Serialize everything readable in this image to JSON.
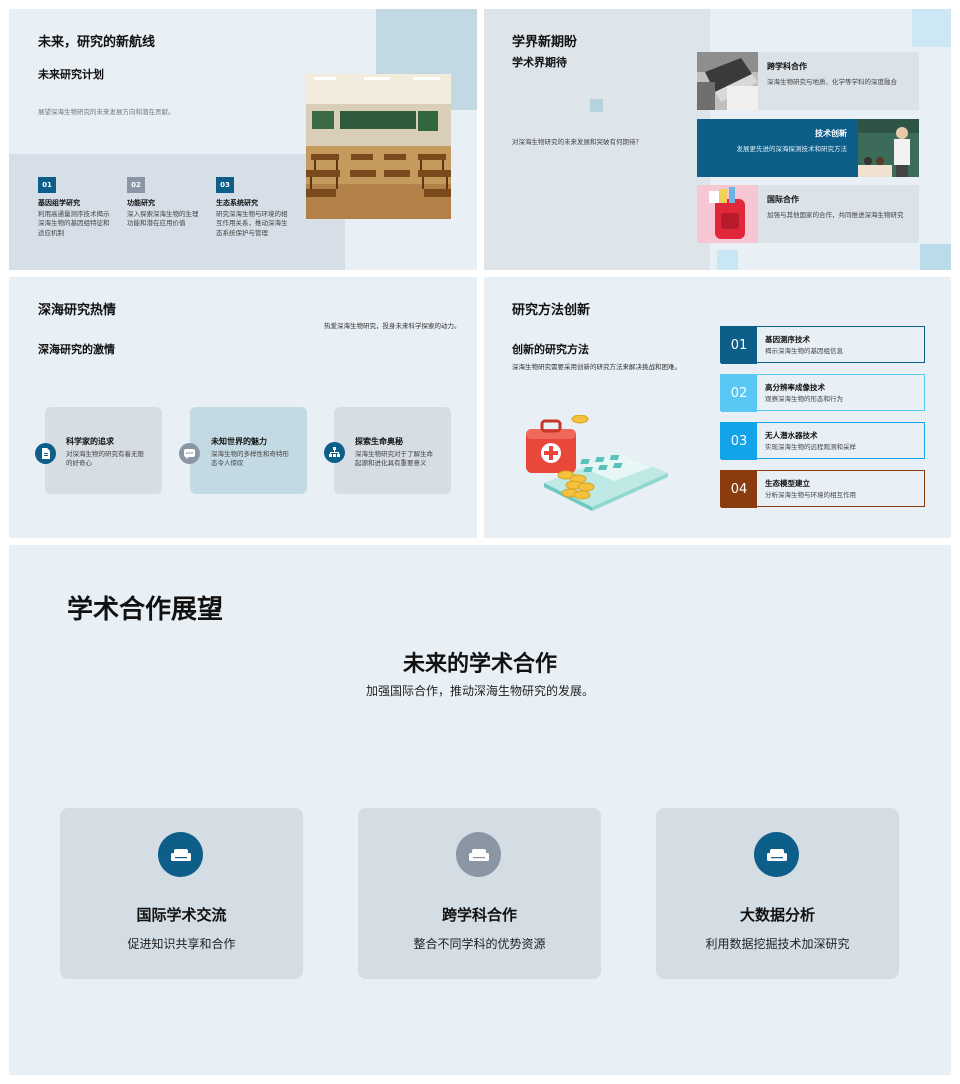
{
  "colors": {
    "slide_bg": "#e8eff5",
    "navy": "#0e5e8a",
    "gray": "#8a96a3",
    "light_blue": "#5ac8f5",
    "sky": "#12a3e8",
    "brown": "#8a3c0e"
  },
  "slide1": {
    "title": "未来，研究的新航线",
    "subtitle": "未来研究计划",
    "description": "展望深海生物研究的未来发展方向和潜在贡献。",
    "items": [
      {
        "num": "01",
        "title": "基因组学研究",
        "desc": "利用高通量测序技术揭示深海生物的基因组特征和适应机制"
      },
      {
        "num": "02",
        "title": "功能研究",
        "desc": "深入探索深海生物的生理功能和潜在应用价值"
      },
      {
        "num": "03",
        "title": "生态系统研究",
        "desc": "研究深海生物与环境的相互作用关系，推动深海生态系统保护与管理"
      }
    ]
  },
  "slide2": {
    "title": "学界新期盼",
    "subtitle": "学术界期待",
    "question": "对深海生物研究的未来发展和突破有何期待？",
    "cards": [
      {
        "title": "跨学科合作",
        "desc": "深海生物研究与地质、化学等学科的深度融合"
      },
      {
        "title": "技术创新",
        "desc": "发展更先进的深海探测技术和研究方法"
      },
      {
        "title": "国际合作",
        "desc": "加强与其他国家的合作，共同推进深海生物研究"
      }
    ]
  },
  "slide3": {
    "title": "深海研究热情",
    "tagline": "热爱深海生物研究，投身未来科学探索的动力。",
    "subtitle": "深海研究的激情",
    "cards": [
      {
        "title": "科学家的追求",
        "desc": "对深海生物的研究有着无限的好奇心",
        "icon": "document-icon"
      },
      {
        "title": "未知世界的魅力",
        "desc": "深海生物的多样性和奇特形态令人惊叹",
        "icon": "chat-icon"
      },
      {
        "title": "探索生命奥秘",
        "desc": "深海生物研究对于了解生命起源和进化具有重要意义",
        "icon": "network-icon"
      }
    ]
  },
  "slide4": {
    "title": "研究方法创新",
    "subtitle": "创新的研究方法",
    "description": "深海生物研究需要采用创新的研究方法来解决挑战和困难。",
    "methods": [
      {
        "num": "01",
        "title": "基因测序技术",
        "desc": "揭示深海生物的基因组信息"
      },
      {
        "num": "02",
        "title": "高分辨率成像技术",
        "desc": "观察深海生物的形态和行为"
      },
      {
        "num": "03",
        "title": "无人潜水器技术",
        "desc": "实现深海生物的远程观测和采样"
      },
      {
        "num": "04",
        "title": "生态模型建立",
        "desc": "分析深海生物与环境的相互作用"
      }
    ]
  },
  "slide5": {
    "title": "学术合作展望",
    "heading": "未来的学术合作",
    "description": "加强国际合作，推动深海生物研究的发展。",
    "cards": [
      {
        "title": "国际学术交流",
        "desc": "促进知识共享和合作",
        "icon": "sofa-icon"
      },
      {
        "title": "跨学科合作",
        "desc": "整合不同学科的优势资源",
        "icon": "sofa-icon"
      },
      {
        "title": "大数据分析",
        "desc": "利用数据挖掘技术加深研究",
        "icon": "sofa-icon"
      }
    ]
  }
}
